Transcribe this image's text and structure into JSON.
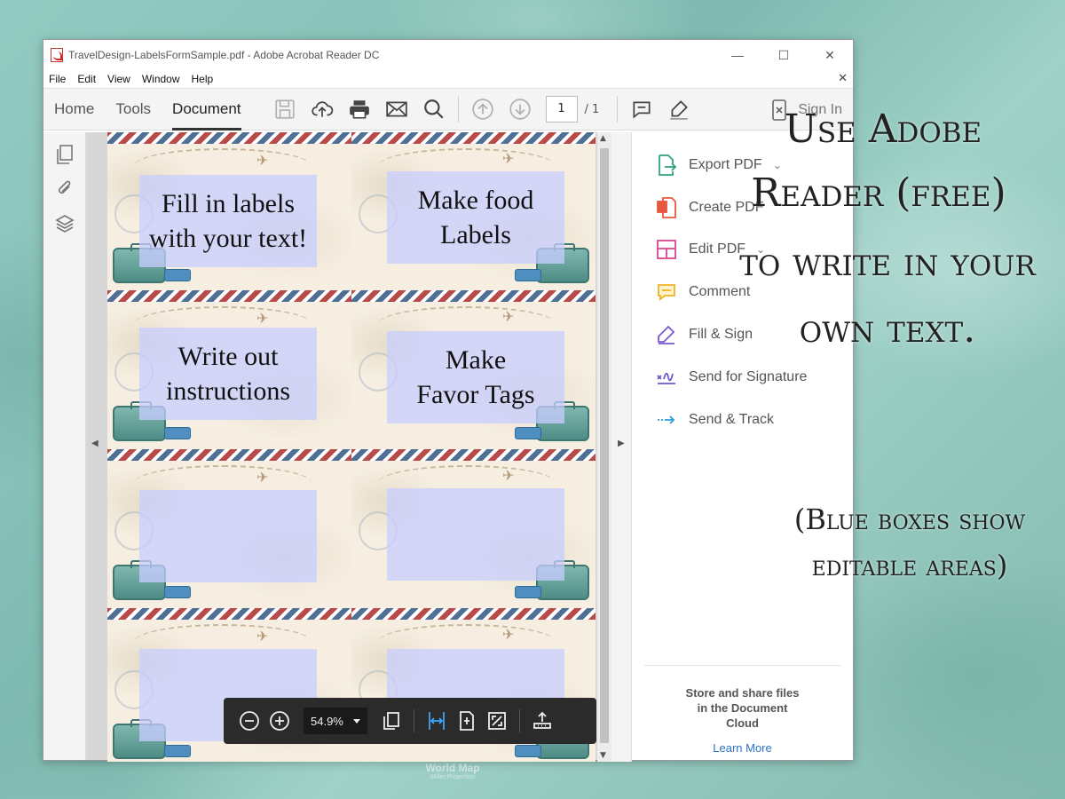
{
  "background": {
    "map_title": "World Map",
    "map_subtitle": "Miller Projection"
  },
  "window": {
    "title": "TravelDesign-LabelsFormSample.pdf - Adobe Acrobat Reader DC",
    "controls": {
      "minimize": "—",
      "maximize": "☐",
      "close": "✕"
    }
  },
  "menu": {
    "items": [
      "File",
      "Edit",
      "View",
      "Window",
      "Help"
    ],
    "close": "✕"
  },
  "toolbar": {
    "tabs": [
      "Home",
      "Tools",
      "Document"
    ],
    "active_tab": "Document",
    "page_current": "1",
    "page_total": "/ 1",
    "sign_in": "Sign In"
  },
  "labels": [
    {
      "text_line1": "Fill in labels",
      "text_line2": "with your text!"
    },
    {
      "text_line1": "Make food",
      "text_line2": "Labels"
    },
    {
      "text_line1": "Write out",
      "text_line2": "instructions"
    },
    {
      "text_line1": "Make",
      "text_line2": "Favor Tags"
    },
    {
      "text_line1": "",
      "text_line2": ""
    },
    {
      "text_line1": "",
      "text_line2": ""
    },
    {
      "text_line1": "",
      "text_line2": ""
    },
    {
      "text_line1": "",
      "text_line2": ""
    }
  ],
  "zoom": {
    "value": "54.9%"
  },
  "right_pane": {
    "items": [
      {
        "label": "Export PDF",
        "icon": "export-pdf-icon",
        "color": "#2fa37f"
      },
      {
        "label": "Create PDF",
        "icon": "create-pdf-icon",
        "color": "#e9573f"
      },
      {
        "label": "Edit PDF",
        "icon": "edit-pdf-icon",
        "color": "#d9468d"
      },
      {
        "label": "Comment",
        "icon": "comment-icon",
        "color": "#f0b323"
      },
      {
        "label": "Fill & Sign",
        "icon": "fill-sign-icon",
        "color": "#7a59d6"
      },
      {
        "label": "Send for Signature",
        "icon": "send-signature-icon",
        "color": "#6a5acd"
      },
      {
        "label": "Send & Track",
        "icon": "send-track-icon",
        "color": "#2d9cdb"
      }
    ],
    "footer_message": "Store and share files in the Document Cloud",
    "learn_more": "Learn More"
  },
  "overlay_text": {
    "line1": "Use Adobe",
    "line2": "Reader (free)",
    "line3": "to write in your",
    "line4": "own text.",
    "note1": "(Blue boxes show",
    "note2": "editable areas)"
  }
}
